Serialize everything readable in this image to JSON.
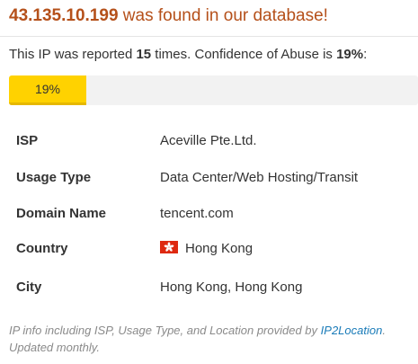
{
  "header": {
    "ip": "43.135.10.199",
    "found_text": " was found in our database!"
  },
  "summary": {
    "prefix": "This IP was reported ",
    "report_count": "15",
    "middle": " times. Confidence of Abuse is ",
    "confidence": "19%",
    "suffix": ":"
  },
  "abuse_bar": {
    "label": "19%",
    "percent": 19,
    "fill_color": "#ffd200",
    "track_color": "#f2f2f2"
  },
  "info_rows": [
    {
      "label": "ISP",
      "value": "Aceville Pte.Ltd."
    },
    {
      "label": "Usage Type",
      "value": "Data Center/Web Hosting/Transit"
    },
    {
      "label": "Domain Name",
      "value": "tencent.com"
    },
    {
      "label": "Country",
      "value": "Hong Kong",
      "icon": "hong-kong-flag-icon"
    },
    {
      "label": "City",
      "value": "Hong Kong, Hong Kong"
    }
  ],
  "footer": {
    "text_before": "IP info including ISP, Usage Type, and Location provided by ",
    "link_text": "IP2Location",
    "text_after": ". Updated monthly."
  },
  "colors": {
    "title": "#b5501a",
    "link": "#1a7bb8",
    "footer_text": "#8a8a8a"
  }
}
